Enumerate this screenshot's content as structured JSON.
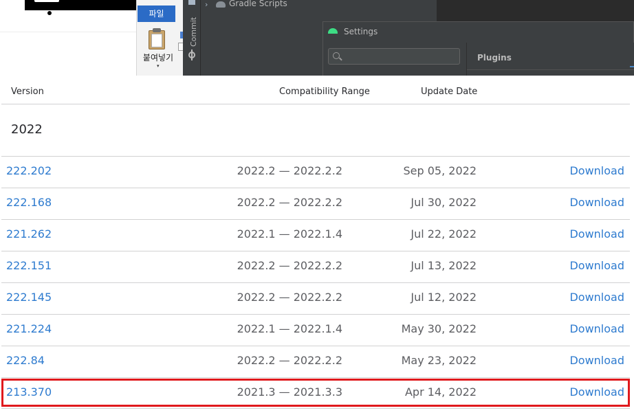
{
  "overlay": {
    "ribbon": {
      "file_tab": "파일",
      "paste_label": "붙여넣기",
      "paste_caret": "▾"
    },
    "ide": {
      "commit_label": "Commit",
      "tree_item": "Gradle Scripts",
      "tree_chevron": "›"
    },
    "settings_dialog": {
      "title": "Settings",
      "search_placeholder": "",
      "section_title": "Plugins"
    }
  },
  "table": {
    "headers": {
      "version": "Version",
      "compatibility": "Compatibility Range",
      "update_date": "Update Date"
    },
    "year": "2022",
    "rows": [
      {
        "version": "222.202",
        "range": "2022.2 — 2022.2.2",
        "date": "Sep 05, 2022",
        "download": "Download",
        "highlighted": false
      },
      {
        "version": "222.168",
        "range": "2022.2 — 2022.2.2",
        "date": "Jul 30, 2022",
        "download": "Download",
        "highlighted": false
      },
      {
        "version": "221.262",
        "range": "2022.1 — 2022.1.4",
        "date": "Jul 22, 2022",
        "download": "Download",
        "highlighted": false
      },
      {
        "version": "222.151",
        "range": "2022.2 — 2022.2.2",
        "date": "Jul 13, 2022",
        "download": "Download",
        "highlighted": false
      },
      {
        "version": "222.145",
        "range": "2022.2 — 2022.2.2",
        "date": "Jul 12, 2022",
        "download": "Download",
        "highlighted": false
      },
      {
        "version": "221.224",
        "range": "2022.1 — 2022.1.4",
        "date": "May 30, 2022",
        "download": "Download",
        "highlighted": false
      },
      {
        "version": "222.84",
        "range": "2022.2 — 2022.2.2",
        "date": "May 23, 2022",
        "download": "Download",
        "highlighted": false
      },
      {
        "version": "213.370",
        "range": "2021.3 — 2021.3.3",
        "date": "Apr 14, 2022",
        "download": "Download",
        "highlighted": true
      }
    ]
  },
  "colors": {
    "link": "#2e7bcf",
    "muted_text": "#5c5d61",
    "highlight_border": "#e0191d",
    "ide_bg": "#3c3f41"
  }
}
